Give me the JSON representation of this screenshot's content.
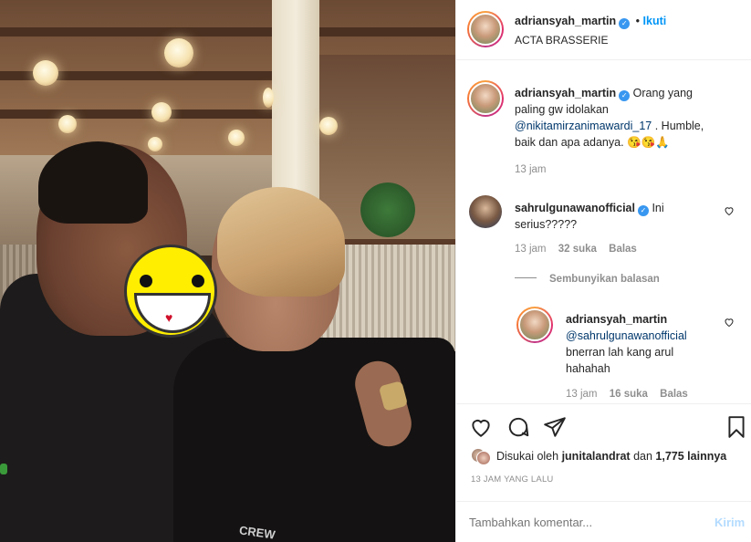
{
  "post": {
    "author": "adriansyah_martin",
    "follow_label": "Ikuti",
    "follow_dot": "•",
    "location": "ACTA BRASSERIE"
  },
  "caption": {
    "author": "adriansyah_martin",
    "text_part1": "Orang yang paling gw idolakan",
    "mention": "@nikitamirzanimawardi_17",
    "text_part2": ". Humble, baik dan apa adanya. 😘😘🙏",
    "time": "13 jam"
  },
  "comments": [
    {
      "author": "sahrulgunawanofficial",
      "text": "Ini serius?????",
      "time": "13 jam",
      "likes": "32 suka",
      "reply_label": "Balas"
    }
  ],
  "hide_replies_label": "Sembunyikan balasan",
  "reply": {
    "author": "adriansyah_martin",
    "mention": "@sahrulgunawanofficial",
    "text": "bnerran lah kang arul hahahah",
    "time": "13 jam",
    "likes": "16 suka",
    "reply_label": "Balas"
  },
  "likes": {
    "prefix": "Disukai oleh",
    "user": "junitalandrat",
    "mid": "dan",
    "count": "1,775 lainnya"
  },
  "timestamp": "13 JAM YANG LALU",
  "comment_box": {
    "placeholder": "Tambahkan komentar...",
    "post_label": "Kirim"
  },
  "photo": {
    "shirt_text": "CREW"
  },
  "icons": {
    "like": "heart-icon",
    "comment": "comment-icon",
    "share": "paper-plane-icon",
    "save": "bookmark-icon"
  },
  "colors": {
    "accent": "#0095f6",
    "verified": "#3897f0",
    "muted": "#8e8e8e",
    "link": "#00376b"
  }
}
